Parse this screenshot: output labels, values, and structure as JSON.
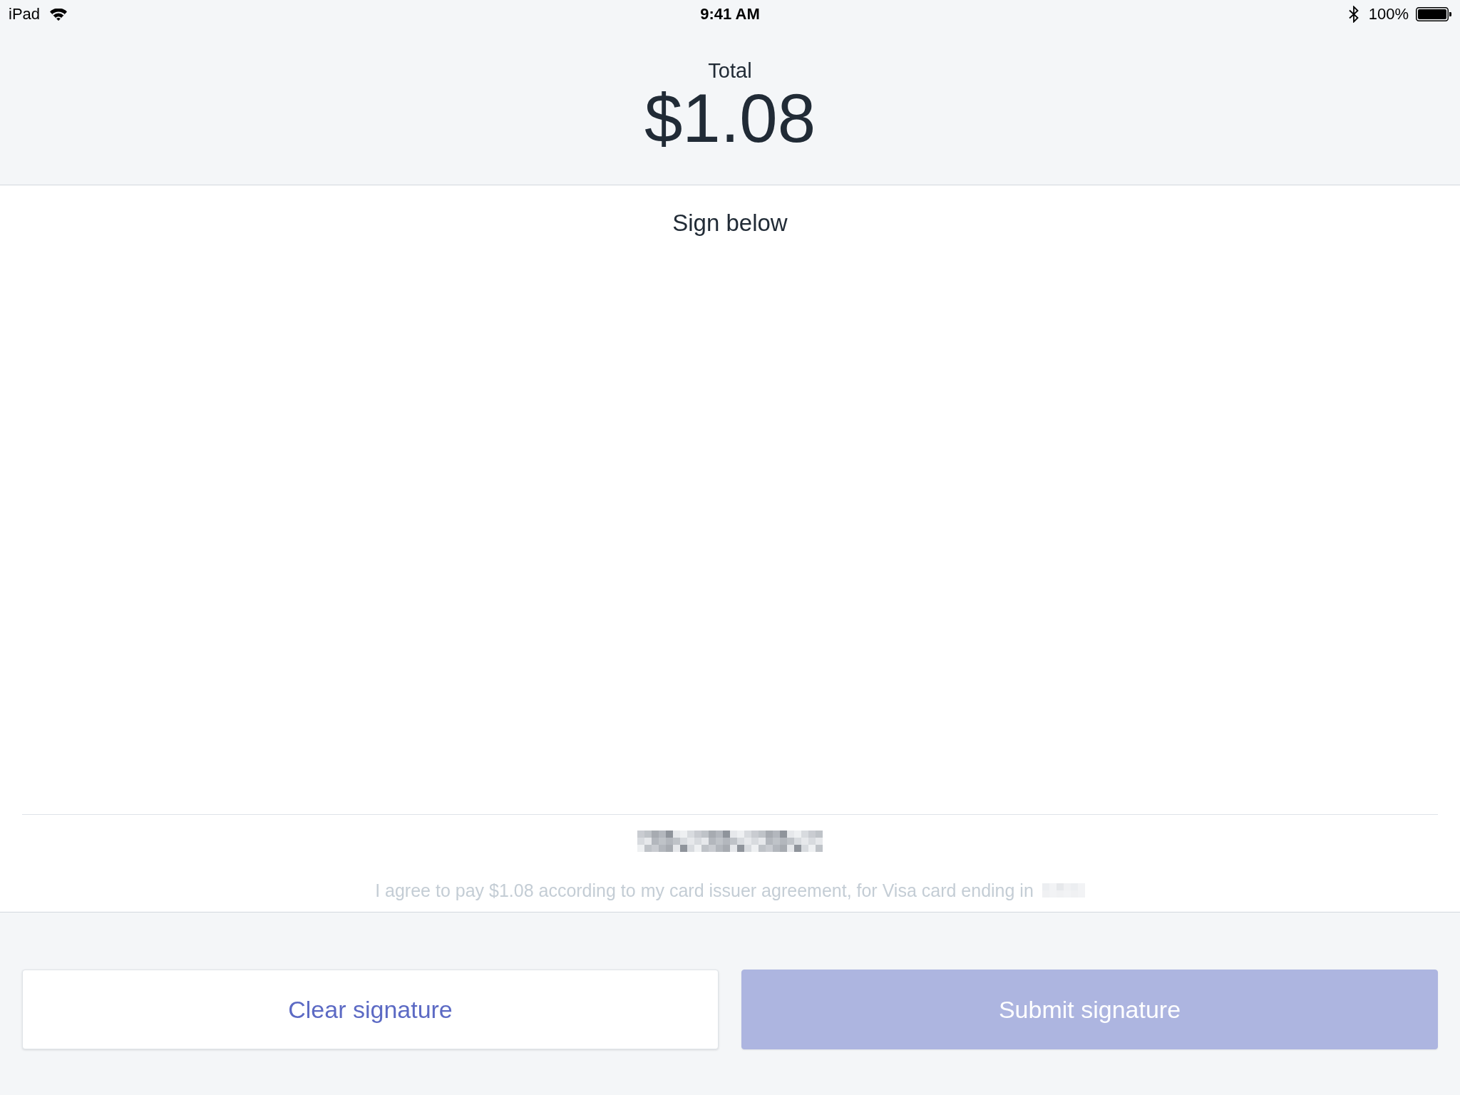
{
  "status_bar": {
    "device": "iPad",
    "time": "9:41 AM",
    "battery": "100%"
  },
  "total": {
    "label": "Total",
    "amount": "$1.08"
  },
  "signature": {
    "prompt": "Sign below",
    "agreement": "I agree to pay $1.08 according to my card issuer agreement, for Visa card ending in"
  },
  "buttons": [
    {
      "label": "Clear signature",
      "kind": "secondary",
      "disabled": false
    },
    {
      "label": "Submit signature",
      "kind": "primary",
      "disabled": true
    }
  ]
}
